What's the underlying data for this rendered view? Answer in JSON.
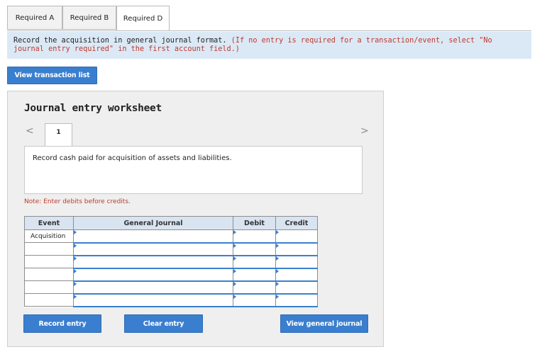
{
  "tabs": [
    {
      "label": "Required A",
      "active": false
    },
    {
      "label": "Required B",
      "active": false
    },
    {
      "label": "Required D",
      "active": true
    }
  ],
  "instructions": {
    "main": "Record the acquisition in general journal format.",
    "note": "(If no entry is required for a transaction/event, select \"No journal entry required\" in the first account field.)"
  },
  "buttons": {
    "view_transaction_list": "View transaction list",
    "record_entry": "Record entry",
    "clear_entry": "Clear entry",
    "view_general_journal": "View general journal"
  },
  "worksheet": {
    "title": "Journal entry worksheet",
    "nav_prev": "<",
    "nav_next": ">",
    "current_page": "1",
    "description": "Record cash paid for acquisition of assets and liabilities.",
    "note": "Note: Enter debits before credits."
  },
  "journal": {
    "headers": {
      "event": "Event",
      "general_journal": "General Journal",
      "debit": "Debit",
      "credit": "Credit"
    },
    "rows": [
      {
        "event": "Acquisition",
        "account": "",
        "debit": "",
        "credit": ""
      },
      {
        "event": "",
        "account": "",
        "debit": "",
        "credit": ""
      },
      {
        "event": "",
        "account": "",
        "debit": "",
        "credit": ""
      },
      {
        "event": "",
        "account": "",
        "debit": "",
        "credit": ""
      },
      {
        "event": "",
        "account": "",
        "debit": "",
        "credit": ""
      },
      {
        "event": "",
        "account": "",
        "debit": "",
        "credit": ""
      }
    ]
  },
  "colors": {
    "accent": "#3a7fcf",
    "banner_bg": "#dbe9f6",
    "note_red": "#c0392b",
    "header_bg": "#d9e4f1"
  }
}
